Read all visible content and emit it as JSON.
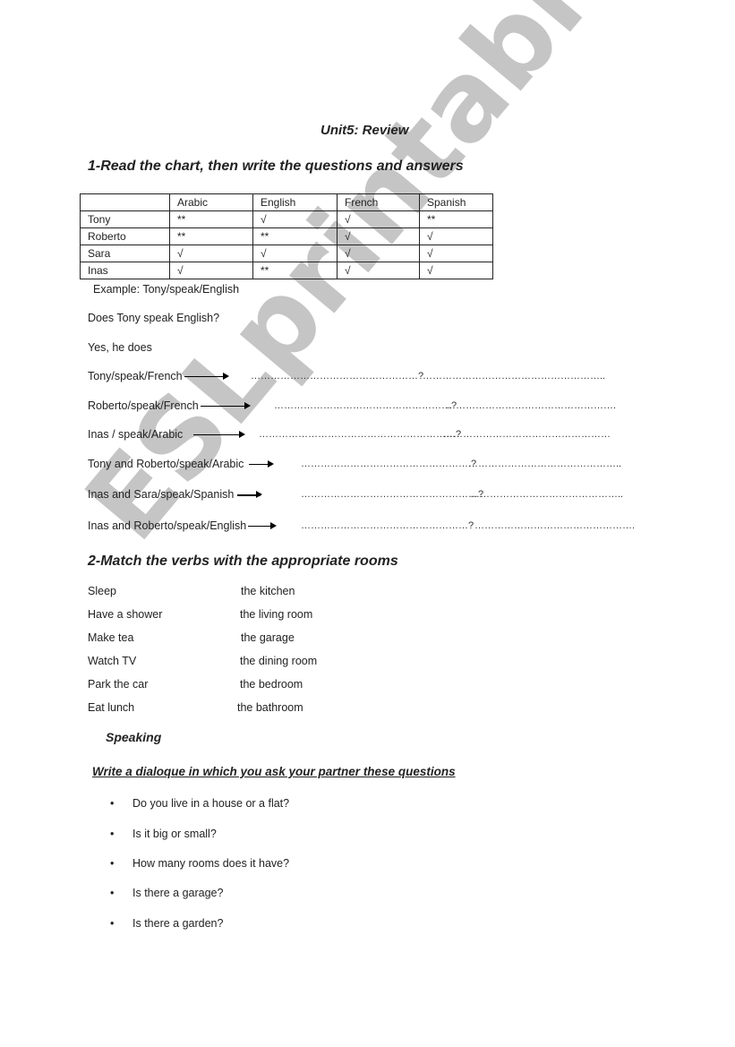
{
  "title": "Unit5: Review",
  "section1": {
    "heading": "1-Read the chart, then write the questions and answers",
    "chart": {
      "headers": [
        "",
        "Arabic",
        "English",
        "French",
        "Spanish"
      ],
      "rows": [
        [
          "Tony",
          "**",
          "√",
          "√",
          "**"
        ],
        [
          "Roberto",
          "**",
          "**",
          "√",
          "√"
        ],
        [
          "Sara",
          "√",
          "√",
          "√",
          "√"
        ],
        [
          "Inas",
          "√",
          "**",
          "√",
          "√"
        ]
      ]
    },
    "example_label": "Example: Tony/speak/English",
    "example_question": "Does Tony speak English?",
    "example_answer": "Yes, he does",
    "prompts": [
      {
        "cue": "Tony/speak/French",
        "question_blank": "……………………………………………?",
        "answer_blank": "……………………………………………….."
      },
      {
        "cue": "Roberto/speak/French",
        "question_blank": "………………………………………………?",
        "answer_blank": "……………………………………………."
      },
      {
        "cue": "Inas / speak/Arabic",
        "question_blank": "……………………………………………………?",
        "answer_blank": "……………………………………………"
      },
      {
        "cue": "Tony and Roberto/speak/Arabic",
        "question_blank": "…………………………………………….?",
        "answer_blank": "……………………………………….."
      },
      {
        "cue": "Inas and Sara/speak/Spanish",
        "question_blank": "………………………………………………?",
        "answer_blank": "……………………………………….."
      },
      {
        "cue": "Inas and Roberto/speak/English",
        "question_blank": "……………………………………………?",
        "answer_blank": "…………………………………………."
      }
    ]
  },
  "section2": {
    "heading": "2-Match the verbs with the appropriate rooms",
    "verbs": [
      "Sleep",
      "Have a shower",
      "Make tea",
      "Watch TV",
      "Park the car",
      "Eat lunch"
    ],
    "rooms": [
      "the kitchen",
      "the living room",
      "the garage",
      "the dining room",
      "the bedroom",
      "the bathroom"
    ]
  },
  "speaking": {
    "heading": "Speaking",
    "instruction": "Write a dialoque in which you ask your partner these questions",
    "bullet_char": "•",
    "questions": [
      "Do you live in a house or a flat?",
      "Is it big or small?",
      "How many rooms does it have?",
      "Is there a garage?",
      "Is there a garden?"
    ]
  },
  "watermark": "ESLprintables.com"
}
